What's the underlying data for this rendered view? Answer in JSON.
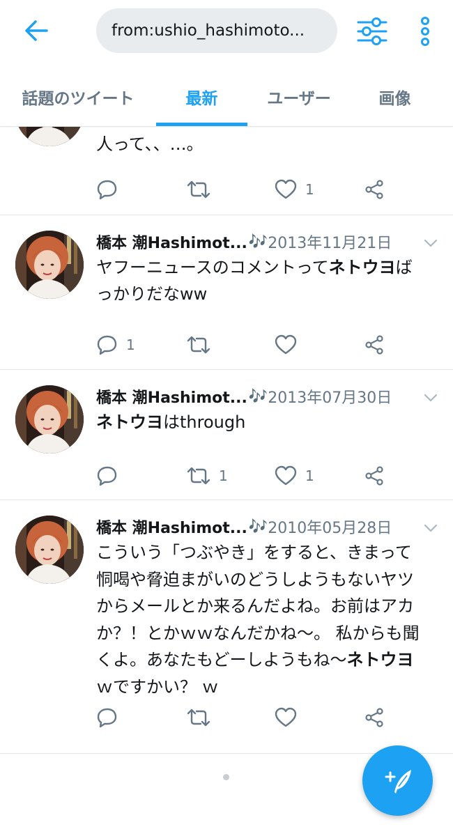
{
  "header": {
    "back_icon": "arrow-left-icon",
    "search_query": "from:ushio_hashimoto...",
    "filter_icon": "sliders-icon",
    "more_icon": "more-vertical-icon"
  },
  "tabs": [
    {
      "label": "話題のツイート"
    },
    {
      "label": "最新"
    },
    {
      "label": "ユーザー"
    },
    {
      "label": "画像"
    }
  ],
  "active_tab": "最新",
  "tweets": [
    {
      "partial": true,
      "text": "人って、、…。",
      "actions": {
        "reply": "",
        "retweet": "",
        "like": "1"
      }
    },
    {
      "author": "橋本 潮Hashimot...",
      "note": "🎶",
      "date": "2013年11月21日",
      "text_parts": [
        "ヤフーニュースのコメントって",
        "ネトウヨ",
        "ばっかりだなww"
      ],
      "actions": {
        "reply": "1",
        "retweet": "",
        "like": ""
      }
    },
    {
      "author": "橋本 潮Hashimot...",
      "note": "🎶",
      "date": "2013年07月30日",
      "text_parts": [
        "",
        "ネトウヨ",
        "はthrough"
      ],
      "actions": {
        "reply": "",
        "retweet": "1",
        "like": "1"
      }
    },
    {
      "author": "橋本 潮Hashimot...",
      "note": "🎶",
      "date": "2010年05月28日",
      "text_parts": [
        "こういう「つぶやき」をすると、きまって恫喝や脅迫まがいのどうしようもないヤツからメールとか来るんだよね。お前はアカか？！とかｗｗなんだかね～。 私からも聞くよ。あなたもどーしようもね～",
        "ネトウヨ",
        "ｗですかい？ ｗ"
      ],
      "actions": {
        "reply": "",
        "retweet": "",
        "like": ""
      }
    }
  ],
  "colors": {
    "accent": "#1da1f2",
    "text": "#14171a",
    "muted": "#657786"
  },
  "fab_icon": "compose-tweet-icon"
}
